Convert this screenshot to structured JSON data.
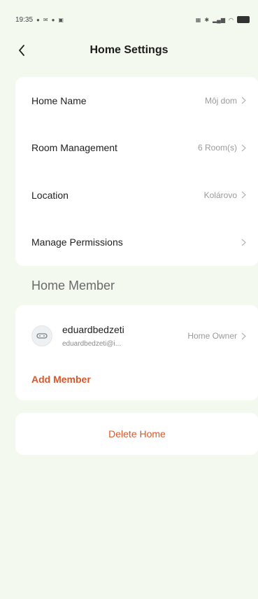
{
  "status_bar": {
    "time": "19:35"
  },
  "header": {
    "title": "Home Settings"
  },
  "settings": [
    {
      "label": "Home Name",
      "value": "Môj dom"
    },
    {
      "label": "Room Management",
      "value": "6 Room(s)"
    },
    {
      "label": "Location",
      "value": "Kolárovo"
    },
    {
      "label": "Manage Permissions",
      "value": ""
    }
  ],
  "members_section": {
    "title": "Home Member",
    "members": [
      {
        "name": "eduardbedzeti",
        "email": "eduardbedzeti@i...",
        "role": "Home Owner"
      }
    ],
    "add_label": "Add Member"
  },
  "delete": {
    "label": "Delete Home"
  },
  "colors": {
    "background": "#f3f9ee",
    "card": "#ffffff",
    "accent": "#d9582b",
    "secondary_text": "#9a9a9a"
  },
  "icons": {
    "back": "chevron-left-icon",
    "row_arrow": "chevron-right-icon",
    "avatar": "user-avatar-icon"
  }
}
